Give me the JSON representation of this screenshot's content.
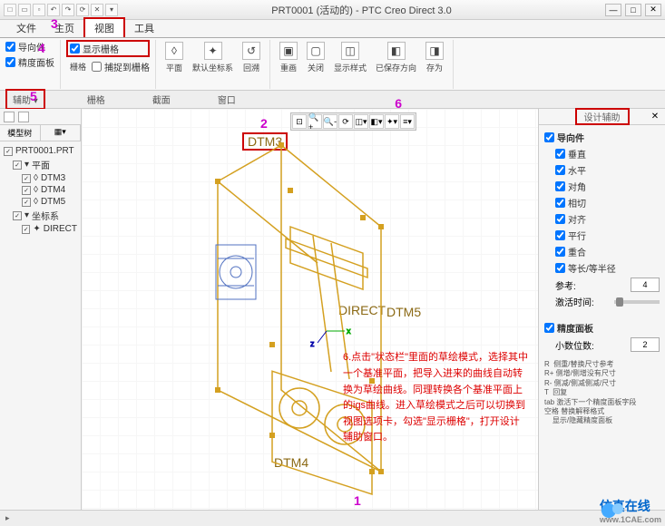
{
  "title": "PRT0001 (活动的) - PTC Creo Direct 3.0",
  "menu": {
    "file": "文件",
    "main": "主页",
    "view": "视图",
    "tools": "工具"
  },
  "ribbon": {
    "orient": "导向件",
    "showgrid": "显示栅格",
    "precision": "精度面板",
    "grid": "栅格",
    "snap": "捕捉到栅格",
    "plane": "平面",
    "coord": "默认坐标系",
    "retrace": "回溯",
    "redraw": "重画",
    "close": "关闭",
    "dispstyle": "显示样式",
    "saved": "已保存方向",
    "saveas": "存为"
  },
  "subtabs": {
    "aux": "辅助",
    "grid": "栅格",
    "section": "截面",
    "window": "窗口"
  },
  "tree": {
    "tab1": "模型树",
    "root": "PRT0001.PRT",
    "plane_group": "平面",
    "dtm3": "DTM3",
    "dtm4": "DTM4",
    "dtm5": "DTM5",
    "coord_group": "坐标系",
    "direct": "DIRECT"
  },
  "canvas": {
    "dtm3": "DTM3",
    "dtm4": "DTM4",
    "dtm5": "DTM5",
    "direct": "DIRECT"
  },
  "rightpanel": {
    "title": "设计辅助",
    "guide": "导向件",
    "vert": "垂直",
    "horiz": "水平",
    "diag": "对角",
    "tangent": "相切",
    "sym": "对齐",
    "parallel": "平行",
    "coincident": "重合",
    "equal": "等长/等半径",
    "ref": "参考:",
    "ref_val": "4",
    "activetime": "激活时间:",
    "precboard": "精度面板",
    "decimal": "小数位数:",
    "decimal_val": "2",
    "help": "R  侧重/替换尺寸参考\nR+ 侧增/侧增没有尺寸\nR- 侧减/侧减侧减/尺寸\nT  回复\ntab 激活下一个精度面板字段\n空格 替换解释格式\n    显示/隐藏精度面板"
  },
  "annotations": {
    "n2": "2",
    "n3": "3",
    "n4": "4",
    "n5": "5",
    "n6": "6",
    "n1": "1",
    "red6": "6.点击\"状态栏\"里面的草绘模式，选择其中一个基准平面，把导入进来的曲线自动转换为草绘曲线。同理转换各个基准平面上的igs曲线。进入草绘模式之后可以切换到视图选项卡，勾选\"显示栅格\"，打开设计辅助窗口。"
  },
  "watermark": {
    "text": "仿真在线",
    "url": "www.1CAE.com"
  }
}
